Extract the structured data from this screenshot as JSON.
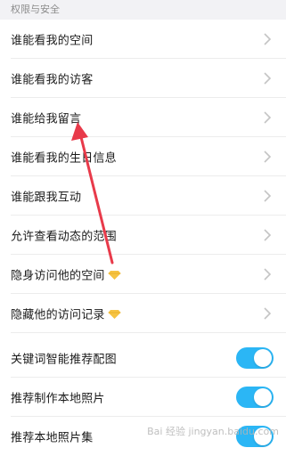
{
  "section": {
    "title": "权限与安全"
  },
  "rows": [
    {
      "label": "谁能看我的空间",
      "control": "chevron"
    },
    {
      "label": "谁能看我的访客",
      "control": "chevron"
    },
    {
      "label": "谁能给我留言",
      "control": "chevron"
    },
    {
      "label": "谁能看我的生日信息",
      "control": "chevron"
    },
    {
      "label": "谁能跟我互动",
      "control": "chevron"
    },
    {
      "label": "允许查看动态的范围",
      "control": "chevron"
    },
    {
      "label": "隐身访问他的空间",
      "control": "chevron",
      "badge": "vip-diamond-icon"
    },
    {
      "label": "隐藏他的访问记录",
      "control": "chevron",
      "badge": "vip-diamond-icon"
    },
    {
      "label": "关键词智能推荐配图",
      "control": "toggle",
      "on": true
    },
    {
      "label": "推荐制作本地照片",
      "control": "toggle",
      "on": true
    },
    {
      "label": "推荐本地照片集",
      "control": "toggle",
      "on": true
    }
  ],
  "watermark": {
    "text": "Bai 经验 jingyan.baidu.com"
  },
  "colors": {
    "toggle_on": "#2bb6f5",
    "chevron": "#c4c4c4",
    "badge": "#f6c343",
    "annotation_arrow": "#e83a4a"
  }
}
